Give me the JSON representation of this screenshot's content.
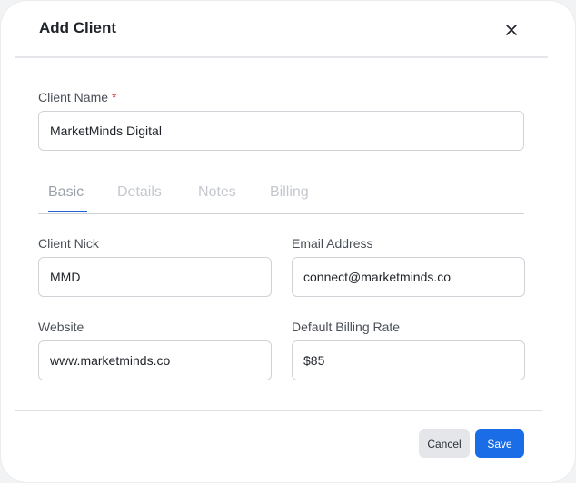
{
  "dialog": {
    "title": "Add Client",
    "close_icon": "close-icon"
  },
  "client_name": {
    "label": "Client Name",
    "required_marker": "*",
    "value": "MarketMinds Digital"
  },
  "tabs": [
    {
      "label": "Basic",
      "active": true
    },
    {
      "label": "Details",
      "active": false
    },
    {
      "label": "Notes",
      "active": false
    },
    {
      "label": "Billing",
      "active": false
    }
  ],
  "basic": {
    "client_nick": {
      "label": "Client Nick",
      "value": "MMD"
    },
    "email": {
      "label": "Email Address",
      "value": "connect@marketminds.co"
    },
    "website": {
      "label": "Website",
      "value": "www.marketminds.co"
    },
    "billing_rate": {
      "label": "Default Billing Rate",
      "value": "$85"
    }
  },
  "footer": {
    "cancel_label": "Cancel",
    "save_label": "Save"
  },
  "colors": {
    "accent": "#1a6de6",
    "required": "#e0464a"
  }
}
